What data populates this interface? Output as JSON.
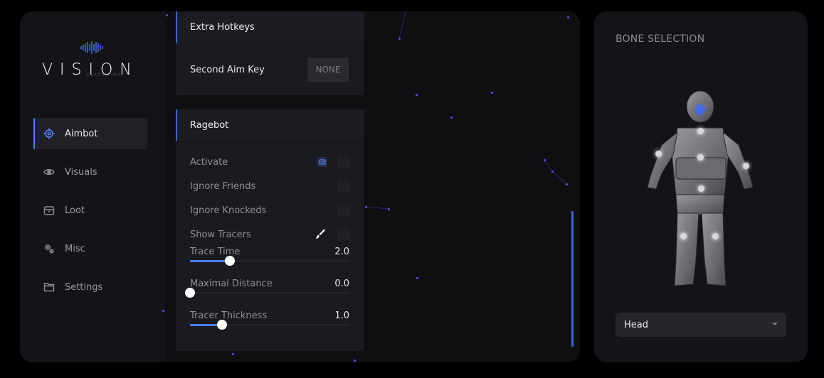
{
  "brand": {
    "subtitle": "CLASSIFIED",
    "name": "VISION"
  },
  "sidebar": {
    "items": [
      {
        "label": "Aimbot",
        "icon": "crosshair-icon",
        "active": true
      },
      {
        "label": "Visuals",
        "icon": "eye-icon",
        "active": false
      },
      {
        "label": "Loot",
        "icon": "box-icon",
        "active": false
      },
      {
        "label": "Misc",
        "icon": "gear-icon",
        "active": false
      },
      {
        "label": "Settings",
        "icon": "folder-icon",
        "active": false
      }
    ]
  },
  "extra_hotkeys": {
    "title": "Extra Hotkeys",
    "second_aim_key_label": "Second Aim Key",
    "second_aim_key_value": "NONE"
  },
  "ragebot": {
    "title": "Ragebot",
    "activate_label": "Activate",
    "ignore_friends_label": "Ignore Friends",
    "ignore_knocked_label": "Ignore Knockeds",
    "show_tracers_label": "Show Tracers",
    "trace_time": {
      "label": "Trace Time",
      "value": "2.0",
      "fraction": 0.25
    },
    "max_distance": {
      "label": "Maximal Distance",
      "value": "0.0",
      "fraction": 0.0
    },
    "tracer_thickness": {
      "label": "Tracer Thickness",
      "value": "1.0",
      "fraction": 0.2
    }
  },
  "bone_selection": {
    "title": "BONE SELECTION",
    "selected": "Head"
  },
  "colors": {
    "accent": "#4a7fff",
    "panel": "#141418",
    "card": "#1a1b20"
  }
}
